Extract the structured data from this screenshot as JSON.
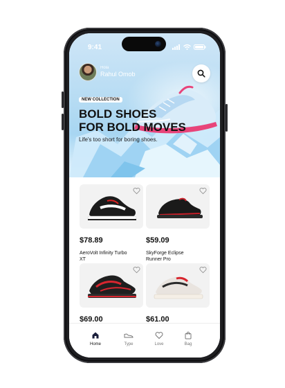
{
  "status_bar": {
    "time": "9:41"
  },
  "header": {
    "greeting": "Hola",
    "user_name": "Rahul Omob"
  },
  "hero": {
    "badge": "NEW COLLECTION",
    "headline_line1": "BOLD SHOES",
    "headline_line2": "FOR BOLD MOVES",
    "tagline": "Life's too short for boring shoes."
  },
  "products": [
    {
      "price": "$78.89",
      "name": "AeroVolt Infinity Turbo XT",
      "icon": "black-white-sneaker"
    },
    {
      "price": "$59.09",
      "name": "SkyForge Eclipse Runner Pro",
      "icon": "black-red-sneaker"
    },
    {
      "price": "$69.00",
      "name": "",
      "icon": "black-red-runner"
    },
    {
      "price": "$61.00",
      "name": "",
      "icon": "white-red-runner"
    }
  ],
  "nav": [
    {
      "label": "Home",
      "icon": "home-icon",
      "active": true
    },
    {
      "label": "Type",
      "icon": "shoe-icon",
      "active": false
    },
    {
      "label": "Love",
      "icon": "heart-icon",
      "active": false
    },
    {
      "label": "Bag",
      "icon": "bag-icon",
      "active": false
    }
  ],
  "colors": {
    "hero_sky": "#b7dcf3",
    "accent_pink": "#e8447a",
    "card_bg": "#f2f2f2",
    "text": "#111111"
  }
}
